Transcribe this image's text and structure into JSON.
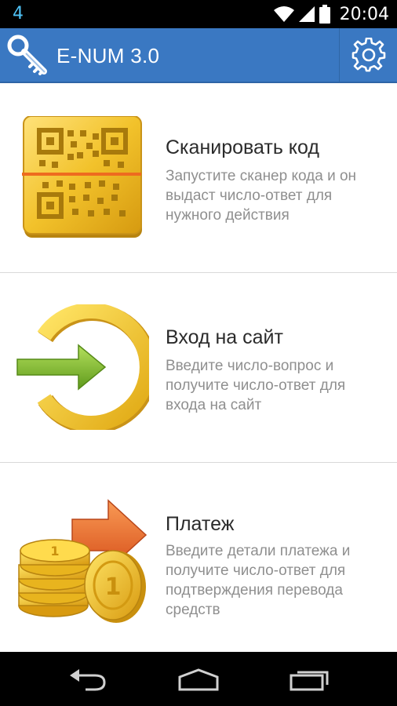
{
  "status_bar": {
    "notification": "4",
    "time": "20:04"
  },
  "app_bar": {
    "title": "E-NUM 3.0",
    "app_icon": "key-icon",
    "settings_icon": "gear-icon"
  },
  "items": [
    {
      "title": "Сканировать код",
      "description": "Запустите сканер кода и он выдаст число-ответ для нужного действия",
      "icon": "qr-scan-icon"
    },
    {
      "title": "Вход на сайт",
      "description": "Введите число-вопрос и получите число-ответ для входа на сайт",
      "icon": "login-arrow-icon"
    },
    {
      "title": "Платеж",
      "description": "Введите детали платежа и получите число-ответ для подтверждения перевода средств",
      "icon": "coins-payment-icon"
    }
  ],
  "nav_bar": {
    "back_icon": "back-icon",
    "home_icon": "home-icon",
    "recents_icon": "recents-icon"
  },
  "colors": {
    "app_bar": "#3a78c2",
    "title_text": "#2b2b2b",
    "desc_text": "#8f8f8f",
    "gold": "#f2c22b",
    "green_arrow": "#7ab828",
    "orange_arrow": "#ee6b1f",
    "notification": "#4fc3f7"
  }
}
